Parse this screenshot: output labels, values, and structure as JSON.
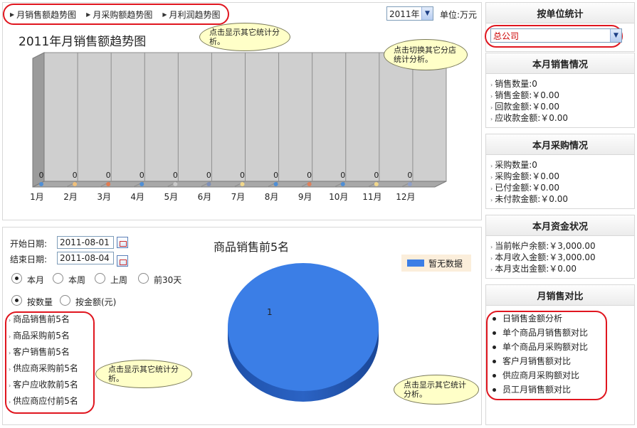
{
  "tabs": [
    {
      "label": "月销售额趋势图"
    },
    {
      "label": "月采购额趋势图"
    },
    {
      "label": "月利润趋势图"
    }
  ],
  "year_select": {
    "value": "2011年"
  },
  "unit_label": "单位:万元",
  "top_callout": "点击显示其它统计分析。",
  "chart_data": {
    "type": "bar",
    "title": "2011年月销售额趋势图",
    "categories": [
      "1月",
      "2月",
      "3月",
      "4月",
      "5月",
      "6月",
      "7月",
      "8月",
      "9月",
      "10月",
      "11月",
      "12月"
    ],
    "values": [
      0,
      0,
      0,
      0,
      0,
      0,
      0,
      0,
      0,
      0,
      0,
      0
    ],
    "point_colors": [
      "#4f8fd6",
      "#f0c07a",
      "#e07a50",
      "#4f8fd6",
      "#c9c9c9",
      "#7d8fb8",
      "#f2d88c",
      "#4f8fd6",
      "#e0805a",
      "#4f8fd6",
      "#f2d88c",
      "#8fa0c8"
    ]
  },
  "right": {
    "header": "按单位统计",
    "unit_select": "总公司",
    "unit_callout": "点击切换其它分店统计分析。",
    "sales": {
      "title": "本月销售情况",
      "items": [
        "销售数量:0",
        "销售金额:￥0.00",
        "回款金额:￥0.00",
        "应收款金额:￥0.00"
      ]
    },
    "purchase": {
      "title": "本月采购情况",
      "items": [
        "采购数量:0",
        "采购金额:￥0.00",
        "已付金额:￥0.00",
        "未付款金额:￥0.00"
      ]
    },
    "funds": {
      "title": "本月资金状况",
      "items": [
        "当前帐户余额:￥3,000.00",
        "本月收入金额:￥3,000.00",
        "本月支出金额:￥0.00"
      ]
    },
    "compare": {
      "title": "月销售对比",
      "items": [
        "日销售金额分析",
        "单个商品月销售额对比",
        "单个商品月采购额对比",
        "客户月销售额对比",
        "供应商月采购额对比",
        "员工月销售额对比"
      ],
      "callout": "点击显示其它统计分析。"
    }
  },
  "bottom": {
    "start_label": "开始日期:",
    "start_date": "2011-08-01",
    "end_label": "结束日期:",
    "end_date": "2011-08-04",
    "period_options": [
      "本月",
      "本周",
      "上周",
      "前30天"
    ],
    "measure_options": [
      "按数量",
      "按金额(元)"
    ],
    "links": [
      "商品销售前5名",
      "商品采购前5名",
      "客户销售前5名",
      "供应商采购前5名",
      "客户应收款前5名",
      "供应商应付前5名"
    ],
    "links_callout": "点击显示其它统计分析。"
  },
  "pie_chart": {
    "type": "pie",
    "title": "商品销售前5名",
    "slices": [
      {
        "label": "1",
        "value": 1,
        "color": "#3b7ee6"
      }
    ],
    "legend": [
      "暂无数据"
    ]
  }
}
